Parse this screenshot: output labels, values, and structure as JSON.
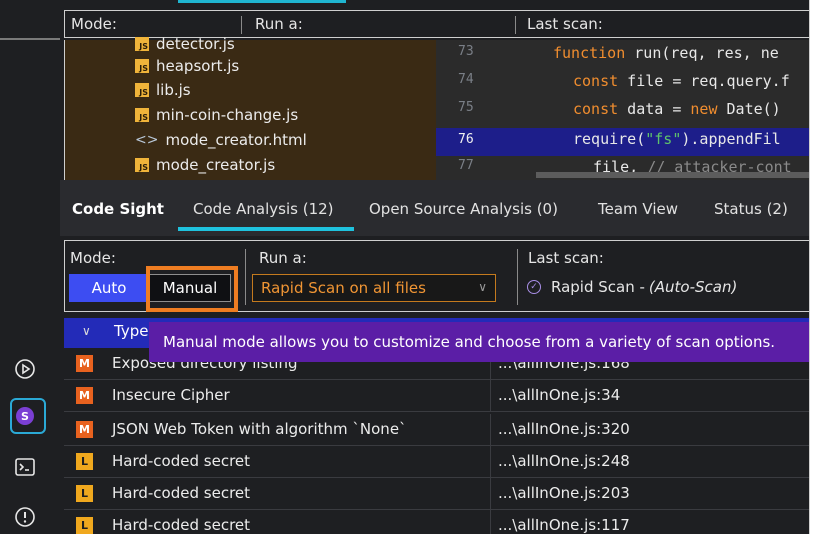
{
  "colors": {
    "accent": "#1fc2de",
    "auto_button": "#3d4df2",
    "highlight_border": "#ef7d22",
    "tooltip_bg": "#5b1ea6",
    "severity_medium": "#e8621f",
    "severity_low": "#f0a81e"
  },
  "ghost_header": {
    "mode_label": "Mode:",
    "run_label": "Run a:",
    "last_scan_label": "Last scan:"
  },
  "file_tree": [
    {
      "name": "detector.js",
      "icon": "js-file-icon"
    },
    {
      "name": "heapsort.js",
      "icon": "js-file-icon"
    },
    {
      "name": "lib.js",
      "icon": "js-file-icon"
    },
    {
      "name": "min-coin-change.js",
      "icon": "js-file-icon"
    },
    {
      "name": "mode_creator.html",
      "icon": "html-file-icon"
    },
    {
      "name": "mode_creator.js",
      "icon": "js-file-icon"
    }
  ],
  "code": {
    "lines": [
      {
        "num": "73"
      },
      {
        "num": "74"
      },
      {
        "num": "75"
      },
      {
        "num": "76"
      },
      {
        "num": "77"
      }
    ],
    "l73": {
      "kw": "function",
      "rest": " run(req, res, ne"
    },
    "l74": {
      "kw": "const",
      "rest": " file = req.query.f"
    },
    "l75": {
      "kw": "const",
      "rest": " data = ",
      "kw2": "new",
      "rest2": " Date()"
    },
    "l76": {
      "pre": "require(",
      "str": "\"fs\"",
      "rest": ").appendFil"
    },
    "l77": {
      "pre": "file, ",
      "comment": "// attacker-cont"
    }
  },
  "tabs": [
    {
      "label": "Code Sight"
    },
    {
      "label": "Code Analysis (12)"
    },
    {
      "label": "Open Source Analysis (0)"
    },
    {
      "label": "Team View"
    },
    {
      "label": "Status (2)"
    }
  ],
  "settings": {
    "mode_label": "Mode:",
    "auto_label": "Auto",
    "manual_label": "Manual",
    "run_label": "Run a:",
    "run_value": "Rapid Scan on all files",
    "last_scan_label": "Last scan:",
    "last_scan_value": "Rapid Scan - ",
    "last_scan_mode": "(Auto-Scan)"
  },
  "tooltip": {
    "text": "Manual mode allows you to customize and choose from a variety of scan options."
  },
  "table": {
    "type_header": "Type",
    "rows": [
      {
        "severity": "M",
        "type": "Exposed directory listing",
        "location": "...\\allInOne.js:168"
      },
      {
        "severity": "M",
        "type": "Insecure Cipher",
        "location": "...\\allInOne.js:34"
      },
      {
        "severity": "M",
        "type": "JSON Web Token with algorithm `None`",
        "location": "...\\allInOne.js:320"
      },
      {
        "severity": "L",
        "type": "Hard-coded secret",
        "location": "...\\allInOne.js:248"
      },
      {
        "severity": "L",
        "type": "Hard-coded secret",
        "location": "...\\allInOne.js:203"
      },
      {
        "severity": "L",
        "type": "Hard-coded secret",
        "location": "...\\allInOne.js:117"
      }
    ]
  },
  "sidebar_icons": [
    "play-circle-icon",
    "synopsys-s-icon",
    "terminal-icon",
    "info-icon"
  ]
}
